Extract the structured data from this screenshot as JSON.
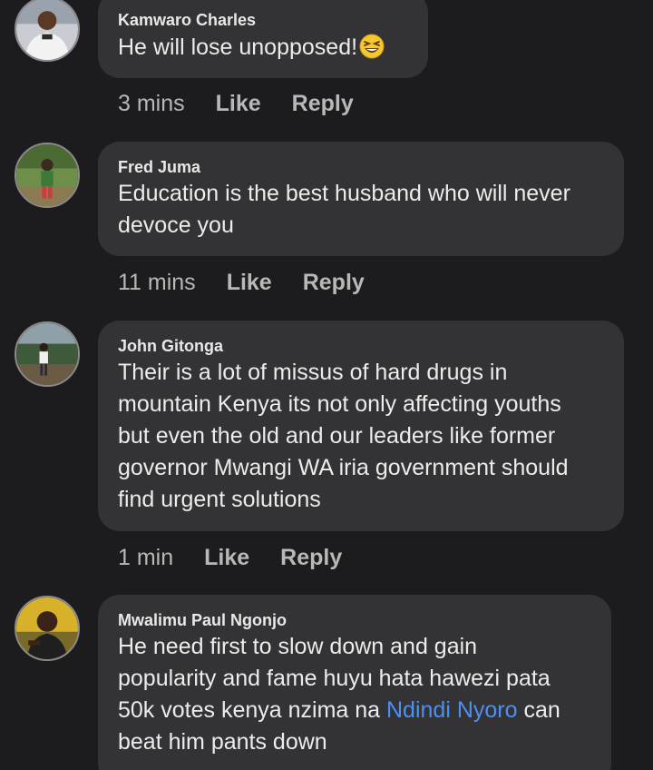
{
  "comments": [
    {
      "author": "Kamwaro Charles",
      "text": "He will lose unopposed!",
      "emoji": "grinning-squinting-face-emoji",
      "time": "3 mins",
      "like": "Like",
      "reply": "Reply"
    },
    {
      "author": "Fred Juma",
      "text_lines": [
        "Education is the best husband who will never",
        "devoce you"
      ],
      "time": "11 mins",
      "like": "Like",
      "reply": "Reply"
    },
    {
      "author": "John Gitonga",
      "text_lines": [
        "Their is a lot of missus of hard drugs in",
        "mountain Kenya its not only affecting youths",
        "but even the old and our leaders like former",
        "governor Mwangi WA iria government should",
        "find urgent solutions"
      ],
      "time": "1 min",
      "like": "Like",
      "reply": "Reply"
    },
    {
      "author": "Mwalimu Paul Ngonjo",
      "text_lines": [
        "He need first to slow down and gain",
        "popularity and fame huyu hata hawezi pata"
      ],
      "line3_before": "50k votes kenya nzima na ",
      "mention": "Ndindi Nyoro",
      "line3_after": " can",
      "line4": "beat him pants down"
    }
  ],
  "colors": {
    "background": "#1c1c1e",
    "bubble": "#333335",
    "text": "#ececec",
    "meta": "#b8b8b8",
    "mention": "#4c8ff5"
  }
}
